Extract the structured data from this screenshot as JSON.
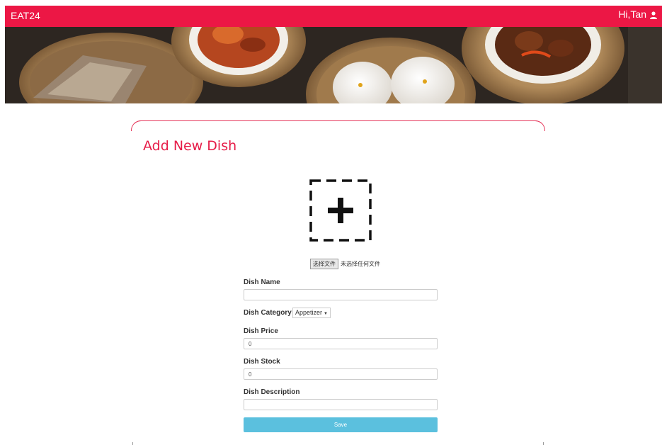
{
  "app": {
    "brand": "EAT24",
    "user_greeting": "Hi,Tan",
    "accent_color": "#ec1745"
  },
  "form": {
    "title": "Add New Dish",
    "upload_icon": "add-image-icon",
    "file_button_label": "选择文件",
    "file_status": "未选择任何文件",
    "dish_name_label": "Dish Name",
    "dish_name_value": "",
    "dish_category_label": "Dish Category",
    "dish_category_selected": "Appetizer",
    "dish_price_label": "Dish Price",
    "dish_price_value": "0",
    "dish_stock_label": "Dish Stock",
    "dish_stock_value": "0",
    "dish_description_label": "Dish Description",
    "dish_description_value": "",
    "save_label": "Save",
    "save_color": "#5bc0de"
  }
}
